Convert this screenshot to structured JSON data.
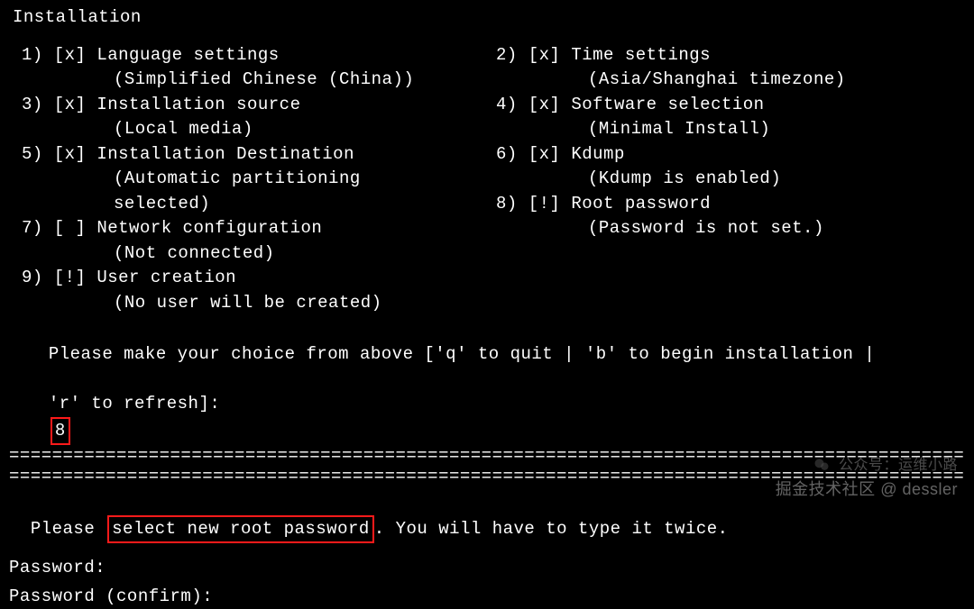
{
  "heading": "Installation",
  "items": [
    {
      "num": "1)",
      "mark": "[x]",
      "title": "Language settings",
      "sub": "(Simplified Chinese (China))"
    },
    {
      "num": "2)",
      "mark": "[x]",
      "title": "Time settings",
      "sub": "(Asia/Shanghai timezone)"
    },
    {
      "num": "3)",
      "mark": "[x]",
      "title": "Installation source",
      "sub": "(Local media)"
    },
    {
      "num": "4)",
      "mark": "[x]",
      "title": "Software selection",
      "sub": "(Minimal Install)"
    },
    {
      "num": "5)",
      "mark": "[x]",
      "title": "Installation Destination",
      "sub": "(Automatic partitioning"
    },
    {
      "num": "6)",
      "mark": "[x]",
      "title": "Kdump",
      "sub": "(Kdump is enabled)"
    },
    {
      "extraSubLeft": "selected)"
    },
    {
      "num": "7)",
      "mark": "[ ]",
      "title": "Network configuration",
      "sub": "(Not connected)"
    },
    {
      "num": "8)",
      "mark": "[!]",
      "title": "Root password",
      "sub": "(Password is not set.)"
    },
    {
      "num": "9)",
      "mark": "[!]",
      "title": "User creation",
      "sub": "(No user will be created)"
    }
  ],
  "prompt": {
    "line1": "Please make your choice from above ['q' to quit | 'b' to begin installation |",
    "line2a": "'r' to refresh]:",
    "input": "8"
  },
  "divider": "================================================================================================",
  "below": {
    "line1a": "Please ",
    "highlight": "select new root password",
    "line1b": ". You will have to type it twice.",
    "pw1": "Password:",
    "pw2": "Password (confirm):"
  },
  "watermark": {
    "l1": "公众号：运维小路",
    "l2": "掘金技术社区 @ dessler"
  }
}
